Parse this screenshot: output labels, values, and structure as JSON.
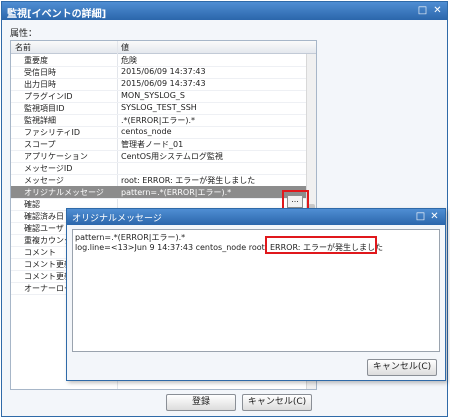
{
  "main_dialog": {
    "title": "監視[イベントの詳細]",
    "attributes_label": "属性：",
    "columns": {
      "name": "名前",
      "value": "値"
    },
    "rows": [
      {
        "name": "重要度",
        "value": "危険"
      },
      {
        "name": "受信日時",
        "value": "2015/06/09 14:37:43"
      },
      {
        "name": "出力日時",
        "value": "2015/06/09 14:37:43"
      },
      {
        "name": "プラグインID",
        "value": "MON_SYSLOG_S"
      },
      {
        "name": "監視項目ID",
        "value": "SYSLOG_TEST_SSH"
      },
      {
        "name": "監視詳細",
        "value": ".*(ERROR|エラー).*"
      },
      {
        "name": "ファシリティID",
        "value": "centos_node"
      },
      {
        "name": "スコープ",
        "value": "管理者ノード_01"
      },
      {
        "name": "アプリケーション",
        "value": "CentOS用システムログ監視"
      },
      {
        "name": "メッセージID",
        "value": ""
      },
      {
        "name": "メッセージ",
        "value": "root: ERROR: エラーが発生しました"
      },
      {
        "name": "オリジナルメッセージ",
        "value": "pattern=.*(ERROR|エラー).*",
        "selected": true
      },
      {
        "name": "確認",
        "value": ""
      },
      {
        "name": "確認済み日",
        "value": ""
      },
      {
        "name": "確認ユーザ",
        "value": ""
      },
      {
        "name": "重複カウンタ",
        "value": ""
      },
      {
        "name": "コメント",
        "value": ""
      },
      {
        "name": "コメント更新",
        "value": ""
      },
      {
        "name": "コメント更新",
        "value": ""
      },
      {
        "name": "オーナーロー",
        "value": ""
      }
    ],
    "ellipsis_label": "...",
    "register_label": "登録",
    "cancel_label": "キャンセル(C)"
  },
  "orig_dialog": {
    "title": "オリジナルメッセージ",
    "line1": "pattern=.*(ERROR|エラー).*",
    "line2": "log.line=<13>Jun  9 14:37:43 centos_node root: ERROR: エラーが発生しました",
    "cancel_label": "キャンセル(C)"
  },
  "colors": {
    "title_bar": "#2b66ab",
    "highlight": "#e0181c",
    "selected_row": "#8c8c8c"
  }
}
